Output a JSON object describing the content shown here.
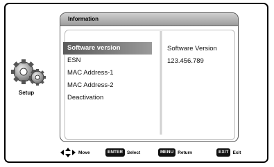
{
  "sidebar": {
    "setup_label": "Setup",
    "setup_icon": "gears-icon"
  },
  "panel": {
    "title": "Information",
    "menu": [
      {
        "label": "Software version",
        "selected": true
      },
      {
        "label": "ESN",
        "selected": false
      },
      {
        "label": "MAC Address-1",
        "selected": false
      },
      {
        "label": "MAC Address-2",
        "selected": false
      },
      {
        "label": "Deactivation",
        "selected": false
      }
    ],
    "detail": {
      "title": "Software Version",
      "value": "123.456.789"
    }
  },
  "footer": {
    "move": {
      "icon": "arrow-keys-icon",
      "label": "Move"
    },
    "select": {
      "key": "ENTER",
      "label": "Select"
    },
    "return": {
      "key": "MENU",
      "label": "Return"
    },
    "exit": {
      "key": "EXIT",
      "label": "Exit"
    }
  }
}
